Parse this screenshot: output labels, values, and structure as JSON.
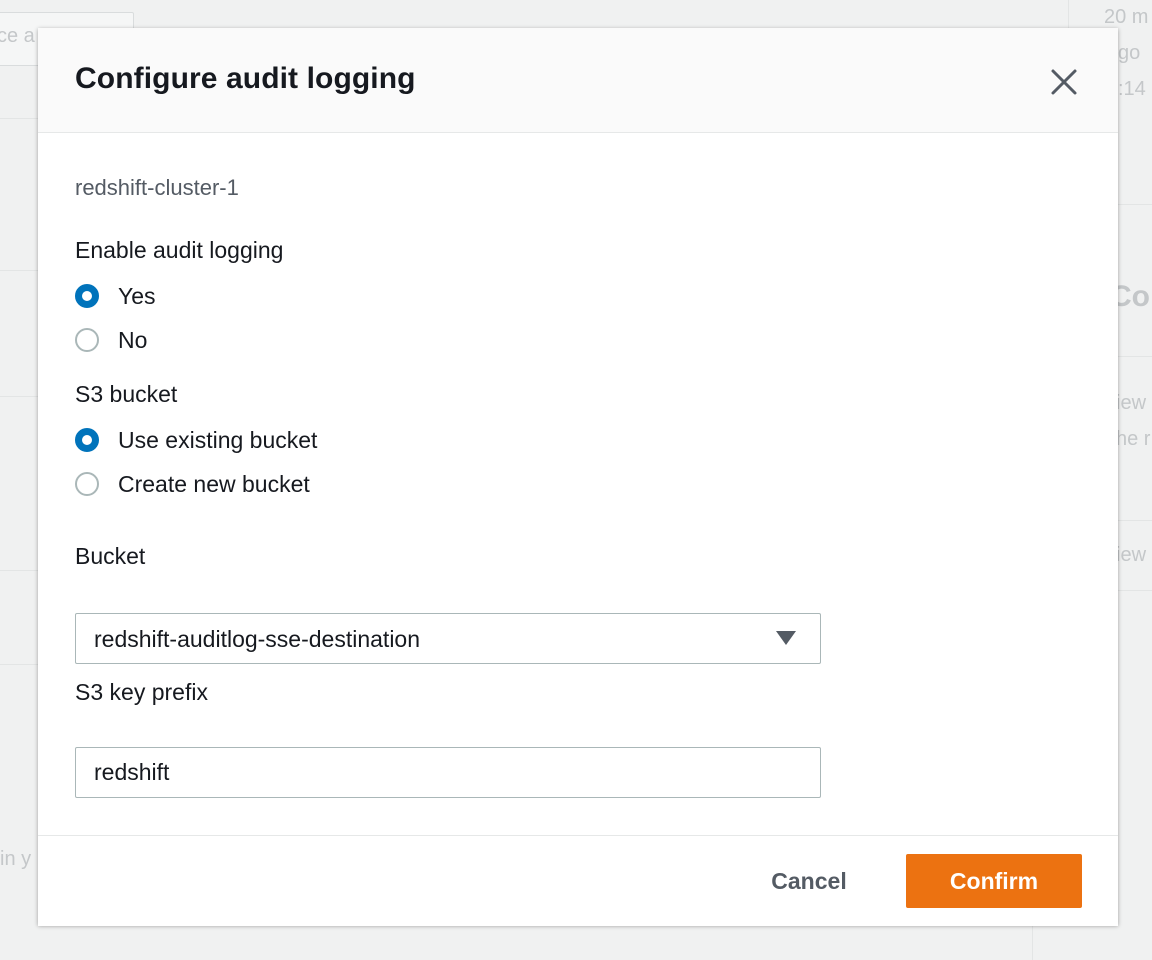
{
  "background": {
    "time_fragment": "20 m",
    "ago_fragment": "go",
    "clock_fragment": ":14",
    "tab_fragment": "ce a",
    "section_fragment": "Co",
    "view_fragment_1": "iew",
    "the_fragment": "he r",
    "view_fragment_2": "iew",
    "in_fragment": "in y"
  },
  "modal": {
    "title": "Configure audit logging",
    "close_label": "Close",
    "cluster_name": "redshift-cluster-1",
    "audit_logging": {
      "label": "Enable audit logging",
      "options": [
        {
          "label": "Yes",
          "checked": true
        },
        {
          "label": "No",
          "checked": false
        }
      ]
    },
    "s3_bucket": {
      "label": "S3 bucket",
      "options": [
        {
          "label": "Use existing bucket",
          "checked": true
        },
        {
          "label": "Create new bucket",
          "checked": false
        }
      ]
    },
    "bucket": {
      "label": "Bucket",
      "selected": "redshift-auditlog-sse-destination"
    },
    "key_prefix": {
      "label": "S3 key prefix",
      "value": "redshift",
      "placeholder": ""
    },
    "footer": {
      "cancel_label": "Cancel",
      "confirm_label": "Confirm"
    }
  },
  "colors": {
    "accent": "#0073bb",
    "primary_button": "#ec7211",
    "text": "#16191f",
    "muted_text": "#545b64"
  },
  "icons": {
    "close": "close-icon",
    "dropdown": "caret-down-icon"
  }
}
